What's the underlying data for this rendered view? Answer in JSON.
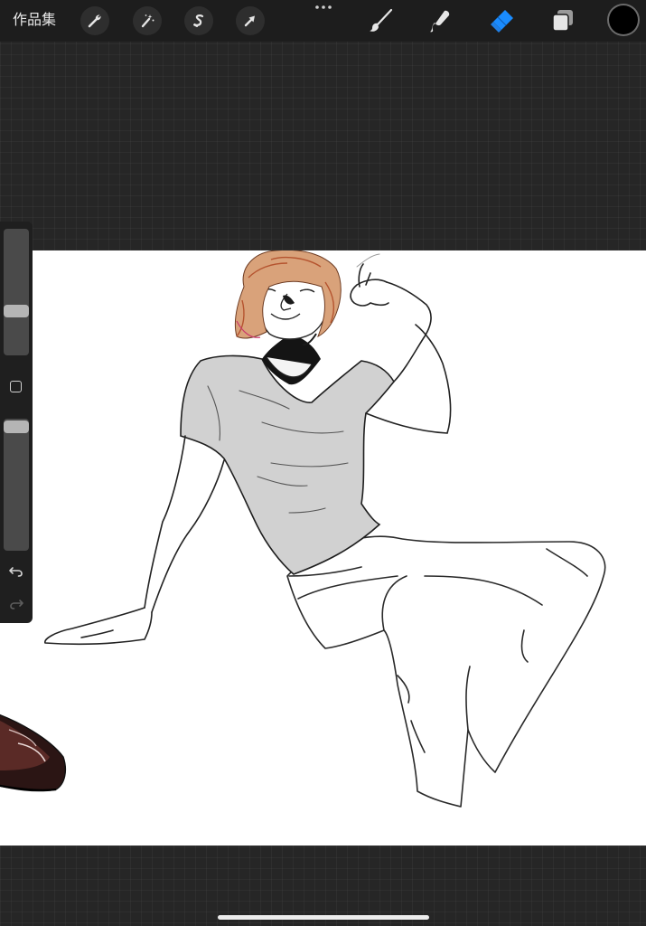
{
  "topbar": {
    "gallery_label": "作品集",
    "tools": [
      {
        "name": "actions",
        "icon": "wrench-icon"
      },
      {
        "name": "adjustments",
        "icon": "magic-wand-icon"
      },
      {
        "name": "selection",
        "icon": "selection-s-icon"
      },
      {
        "name": "transform",
        "icon": "arrow-cursor-icon"
      },
      {
        "name": "more",
        "icon": "ellipsis-icon"
      },
      {
        "name": "brush",
        "icon": "brush-icon"
      },
      {
        "name": "smudge",
        "icon": "smudge-icon"
      },
      {
        "name": "eraser",
        "icon": "eraser-icon",
        "active": true
      },
      {
        "name": "layers",
        "icon": "layers-icon"
      }
    ],
    "active_color": "#000000",
    "accent_color": "#1a8cff"
  },
  "sidebar": {
    "brush_size_level": 0.6,
    "opacity_level": 0.95,
    "modify_icon": "square-icon",
    "undo_icon": "undo-icon",
    "redo_icon": "redo-icon"
  },
  "canvas": {
    "background": "#ffffff",
    "artwork": "sketch-figure"
  }
}
